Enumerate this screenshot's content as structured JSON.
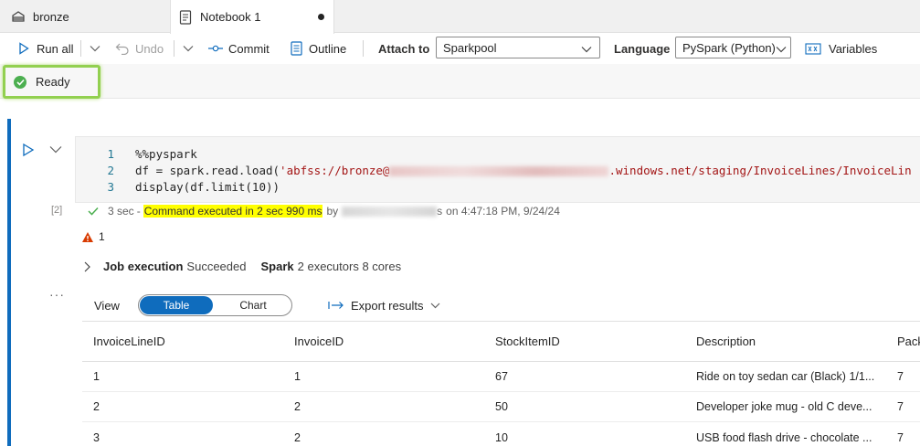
{
  "tabs": {
    "lakehouse_label": "bronze",
    "notebook_label": "Notebook 1"
  },
  "toolbar": {
    "run_all": "Run all",
    "undo": "Undo",
    "commit": "Commit",
    "outline": "Outline",
    "attach_to_label": "Attach to",
    "attach_to_value": "Sparkpool",
    "language_label": "Language",
    "language_value": "PySpark (Python)",
    "variables": "Variables"
  },
  "status": {
    "text": "Ready",
    "highlight_color": "#92d050"
  },
  "cell": {
    "exec_count": "[2]",
    "lines": [
      {
        "n": "1",
        "text": "%%pyspark"
      },
      {
        "n": "2",
        "prefix": "df = spark.read.load(",
        "str_start": "'abfss://bronze@",
        "str_end": ".windows.net/staging/InvoiceLines/InvoiceLin"
      },
      {
        "n": "3",
        "text": "display(df.limit(10))"
      }
    ],
    "exec_duration": "3 sec",
    "exec_dash": "-",
    "exec_message": "Command executed in 2 sec 990 ms",
    "exec_by": "by",
    "exec_user_tail": "s",
    "exec_timestamp": "on 4:47:18 PM, 9/24/24",
    "warning_count": "1",
    "job_label": "Job execution",
    "job_status": "Succeeded",
    "spark_label": "Spark",
    "spark_info": "2 executors 8 cores"
  },
  "output": {
    "view_label": "View",
    "view_table": "Table",
    "view_chart": "Chart",
    "export_label": "Export results",
    "columns": [
      "InvoiceLineID",
      "InvoiceID",
      "StockItemID",
      "Description",
      "Pack"
    ],
    "rows": [
      [
        "1",
        "1",
        "67",
        "Ride on toy sedan car (Black) 1/1...",
        "7"
      ],
      [
        "2",
        "2",
        "50",
        "Developer joke mug - old C deve...",
        "7"
      ],
      [
        "3",
        "2",
        "10",
        "USB food flash drive - chocolate ...",
        "7"
      ]
    ]
  },
  "colors": {
    "accent": "#0f6cbd",
    "string": "#a31515",
    "highlight": "#ffff00",
    "success": "#4caf50",
    "warning": "#d83b01"
  }
}
